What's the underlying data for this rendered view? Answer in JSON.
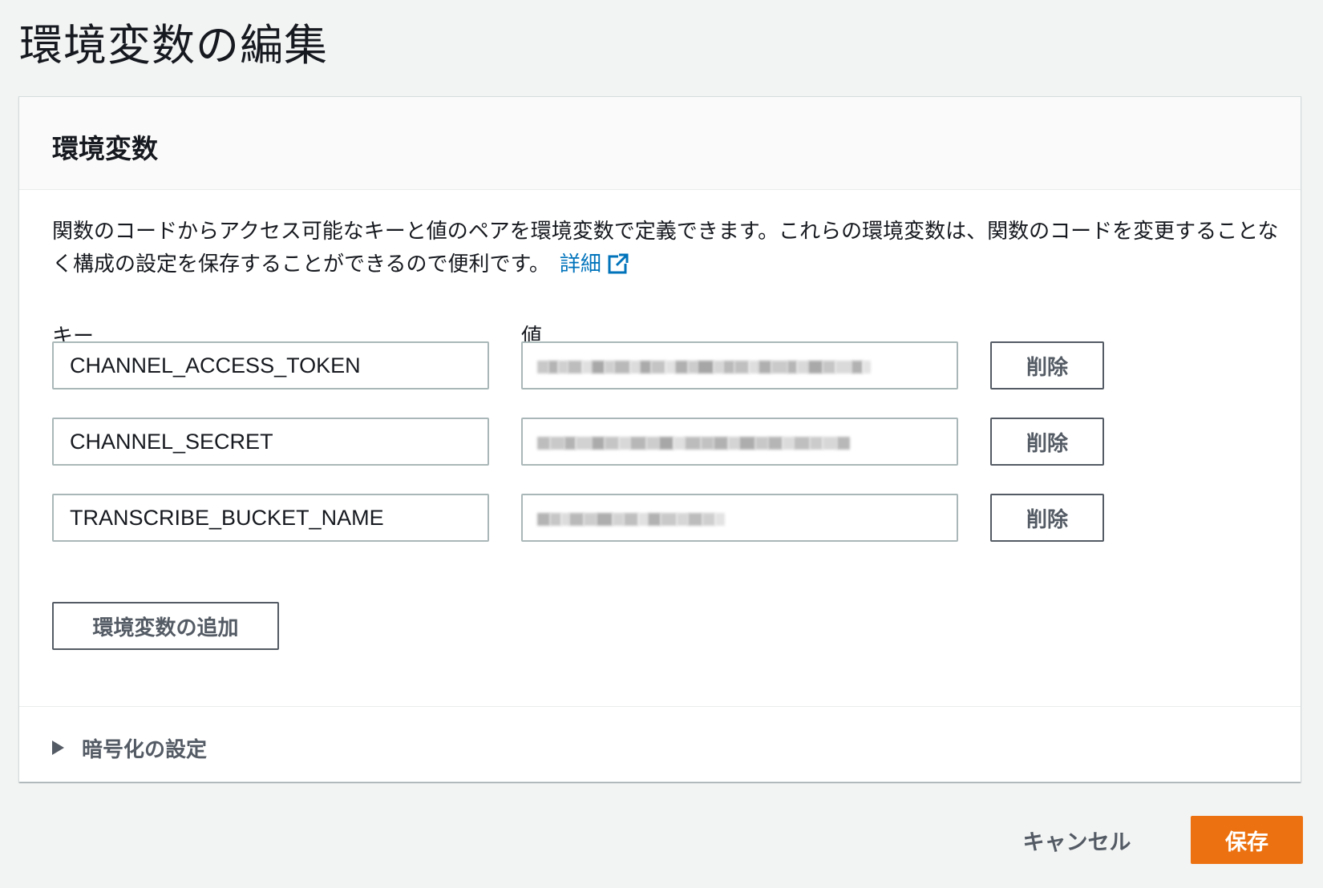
{
  "page": {
    "title": "環境変数の編集"
  },
  "panel": {
    "title": "環境変数",
    "description": "関数のコードからアクセス可能なキーと値のペアを環境変数で定義できます。これらの環境変数は、関数のコードを変更することなく構成の設定を保存することができるので便利です。",
    "learn_more_label": "詳細",
    "key_column_label": "キー",
    "value_column_label": "値",
    "rows": [
      {
        "key": "CHANNEL_ACCESS_TOKEN",
        "value_obscured": true
      },
      {
        "key": "CHANNEL_SECRET",
        "value_obscured": true
      },
      {
        "key": "TRANSCRIBE_BUCKET_NAME",
        "value_obscured": true
      }
    ],
    "delete_label": "削除",
    "add_label": "環境変数の追加",
    "encryption_expander_label": "暗号化の設定"
  },
  "footer": {
    "cancel_label": "キャンセル",
    "save_label": "保存"
  },
  "colors": {
    "accent": "#ec7211",
    "link": "#0073bb",
    "button_text": "#545b64"
  },
  "icons": {
    "learn_more": "external-link-icon",
    "expander": "caret-right-icon"
  }
}
